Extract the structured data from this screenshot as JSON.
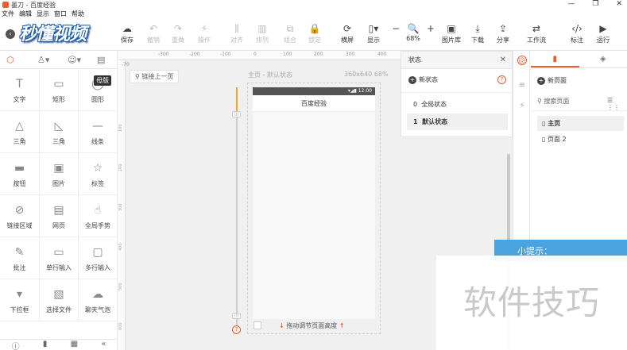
{
  "window": {
    "title": "墨刀 - 百度经验",
    "buttons": [
      "—",
      "❐",
      "✕"
    ]
  },
  "menu": [
    "文件",
    "编辑",
    "显示",
    "窗口",
    "帮助"
  ],
  "logo_text": "秒懂视频",
  "toolbar": {
    "save": "保存",
    "undo": "撤销",
    "redo": "重做",
    "action": "操作",
    "align": "对齐",
    "distribute": "排列",
    "group": "组合",
    "lock": "锁定",
    "landscape": "横屏",
    "display": "显示",
    "zoom": "68%",
    "gallery": "图片库",
    "download": "下载",
    "share": "分享",
    "workflow": "工作流",
    "annotate": "标注",
    "run": "运行"
  },
  "left_panel": {
    "tooltip": "母版",
    "components": [
      {
        "icon": "T",
        "label": "文字"
      },
      {
        "icon": "▭",
        "label": "矩形"
      },
      {
        "icon": "◯",
        "label": "圆形"
      },
      {
        "icon": "△",
        "label": "三角"
      },
      {
        "icon": "◺",
        "label": "三角"
      },
      {
        "icon": "—",
        "label": "线条"
      },
      {
        "icon": "▬",
        "label": "按钮"
      },
      {
        "icon": "▣",
        "label": "图片"
      },
      {
        "icon": "☆",
        "label": "标签"
      },
      {
        "icon": "⊘",
        "label": "链接区域"
      },
      {
        "icon": "▤",
        "label": "网页"
      },
      {
        "icon": "☝",
        "label": "全局手势"
      },
      {
        "icon": "✎",
        "label": "批注"
      },
      {
        "icon": "▭",
        "label": "单行输入"
      },
      {
        "icon": "▢",
        "label": "多行输入"
      },
      {
        "icon": "▾",
        "label": "下拉框"
      },
      {
        "icon": "▧",
        "label": "选择文件"
      },
      {
        "icon": "☁",
        "label": "聊天气泡"
      }
    ]
  },
  "canvas": {
    "ruler_marks": [
      "-300",
      "-200",
      "-100",
      "0",
      "100",
      "200",
      "300",
      "400"
    ],
    "vruler_marks": [
      "100",
      "200",
      "300",
      "400",
      "500",
      "600"
    ],
    "ruler_origin": "-70",
    "link_prev": "链接上一页",
    "page_label": "主页 - 默认状态",
    "page_size": "360x640 68%",
    "phone_time": "12:00",
    "phone_title": "百度经验",
    "drag_hint": "拖动调节页面高度"
  },
  "states_panel": {
    "title": "状态",
    "new_state": "新状态",
    "rows": [
      {
        "num": "0",
        "label": "全局状态"
      },
      {
        "num": "1",
        "label": "默认状态"
      }
    ]
  },
  "right_panel": {
    "new_page": "新页面",
    "search_placeholder": "搜索页面",
    "pages": [
      "主页",
      "页面 2"
    ]
  },
  "tip_banner": "小提示：",
  "watermark": "软件技巧",
  "colors": {
    "accent": "#f25a29",
    "tip": "#4aa3df"
  }
}
